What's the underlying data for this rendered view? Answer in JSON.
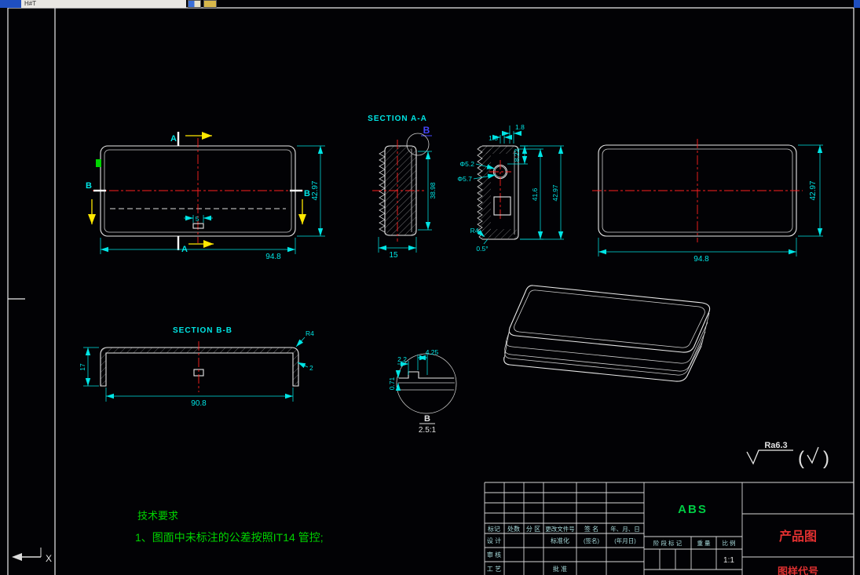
{
  "chrome": {
    "menu_text": "H#T"
  },
  "colors": {
    "background": "#020205",
    "geometry": "#e8e8e8",
    "dimensions": "#00e5e5",
    "centerline": "#ff2020",
    "section_arrow": "#ffe800",
    "notes_green": "#00d400",
    "material_green": "#00cc44",
    "title_red": "#e03030",
    "detail_marker_blue": "#4646ff"
  },
  "front_view": {
    "label_a_top": "A",
    "label_a_bottom": "A",
    "label_b_left": "B",
    "label_b_right": "B",
    "dim_width": "94.8",
    "dim_height": "42.97",
    "dim_slot": "5"
  },
  "section_aa": {
    "title": "SECTION A-A",
    "detail_marker": "B",
    "dim_inner_height": "38.98",
    "dim_depth": "15"
  },
  "side_view": {
    "dim_18_outer": "1.8",
    "dim_18_inner": "1.8",
    "dim_822": "8.22",
    "dim_416": "41.6",
    "dim_4297": "42.97",
    "dim_phi52": "Φ5.2",
    "dim_phi57": "Φ5.7",
    "dim_r4": "R4",
    "dim_angle": "0.5°"
  },
  "right_view": {
    "dim_width": "94.8",
    "dim_height": "42.97"
  },
  "section_bb": {
    "title": "SECTION B-B",
    "dim_height": "17",
    "dim_inner_width": "90.8",
    "dim_r4": "R4",
    "dim_wall": "2"
  },
  "detail_b": {
    "dim_425": "4.25",
    "dim_22": "2.2",
    "dim_071": "0.71",
    "label": "B",
    "scale": "2.5:1"
  },
  "notes": {
    "heading": "技术要求",
    "item1": "1、图面中未标注的公差按照IT14 管控;"
  },
  "roughness": {
    "value": "Ra6.3"
  },
  "title_block": {
    "material": "ABS",
    "product_name": "产品图",
    "drawing_code_label": "图样代号",
    "scale_value": "1:1",
    "col_mark": "标记",
    "col_count": "处数",
    "col_zone": "分 区",
    "col_doc": "更改文件号",
    "col_sign": "签 名",
    "col_date": "年、月、日",
    "row_design": "设 计",
    "row_std": "标准化",
    "ph_sign": "(签名)",
    "ph_date": "(年月日)",
    "row_review": "审 核",
    "row_process": "工 艺",
    "row_approve": "批 准",
    "stage_label": "阶 段 标 记",
    "weight_label": "重 量",
    "scale_label": "比 例"
  },
  "ucs": {
    "axis": "X"
  }
}
